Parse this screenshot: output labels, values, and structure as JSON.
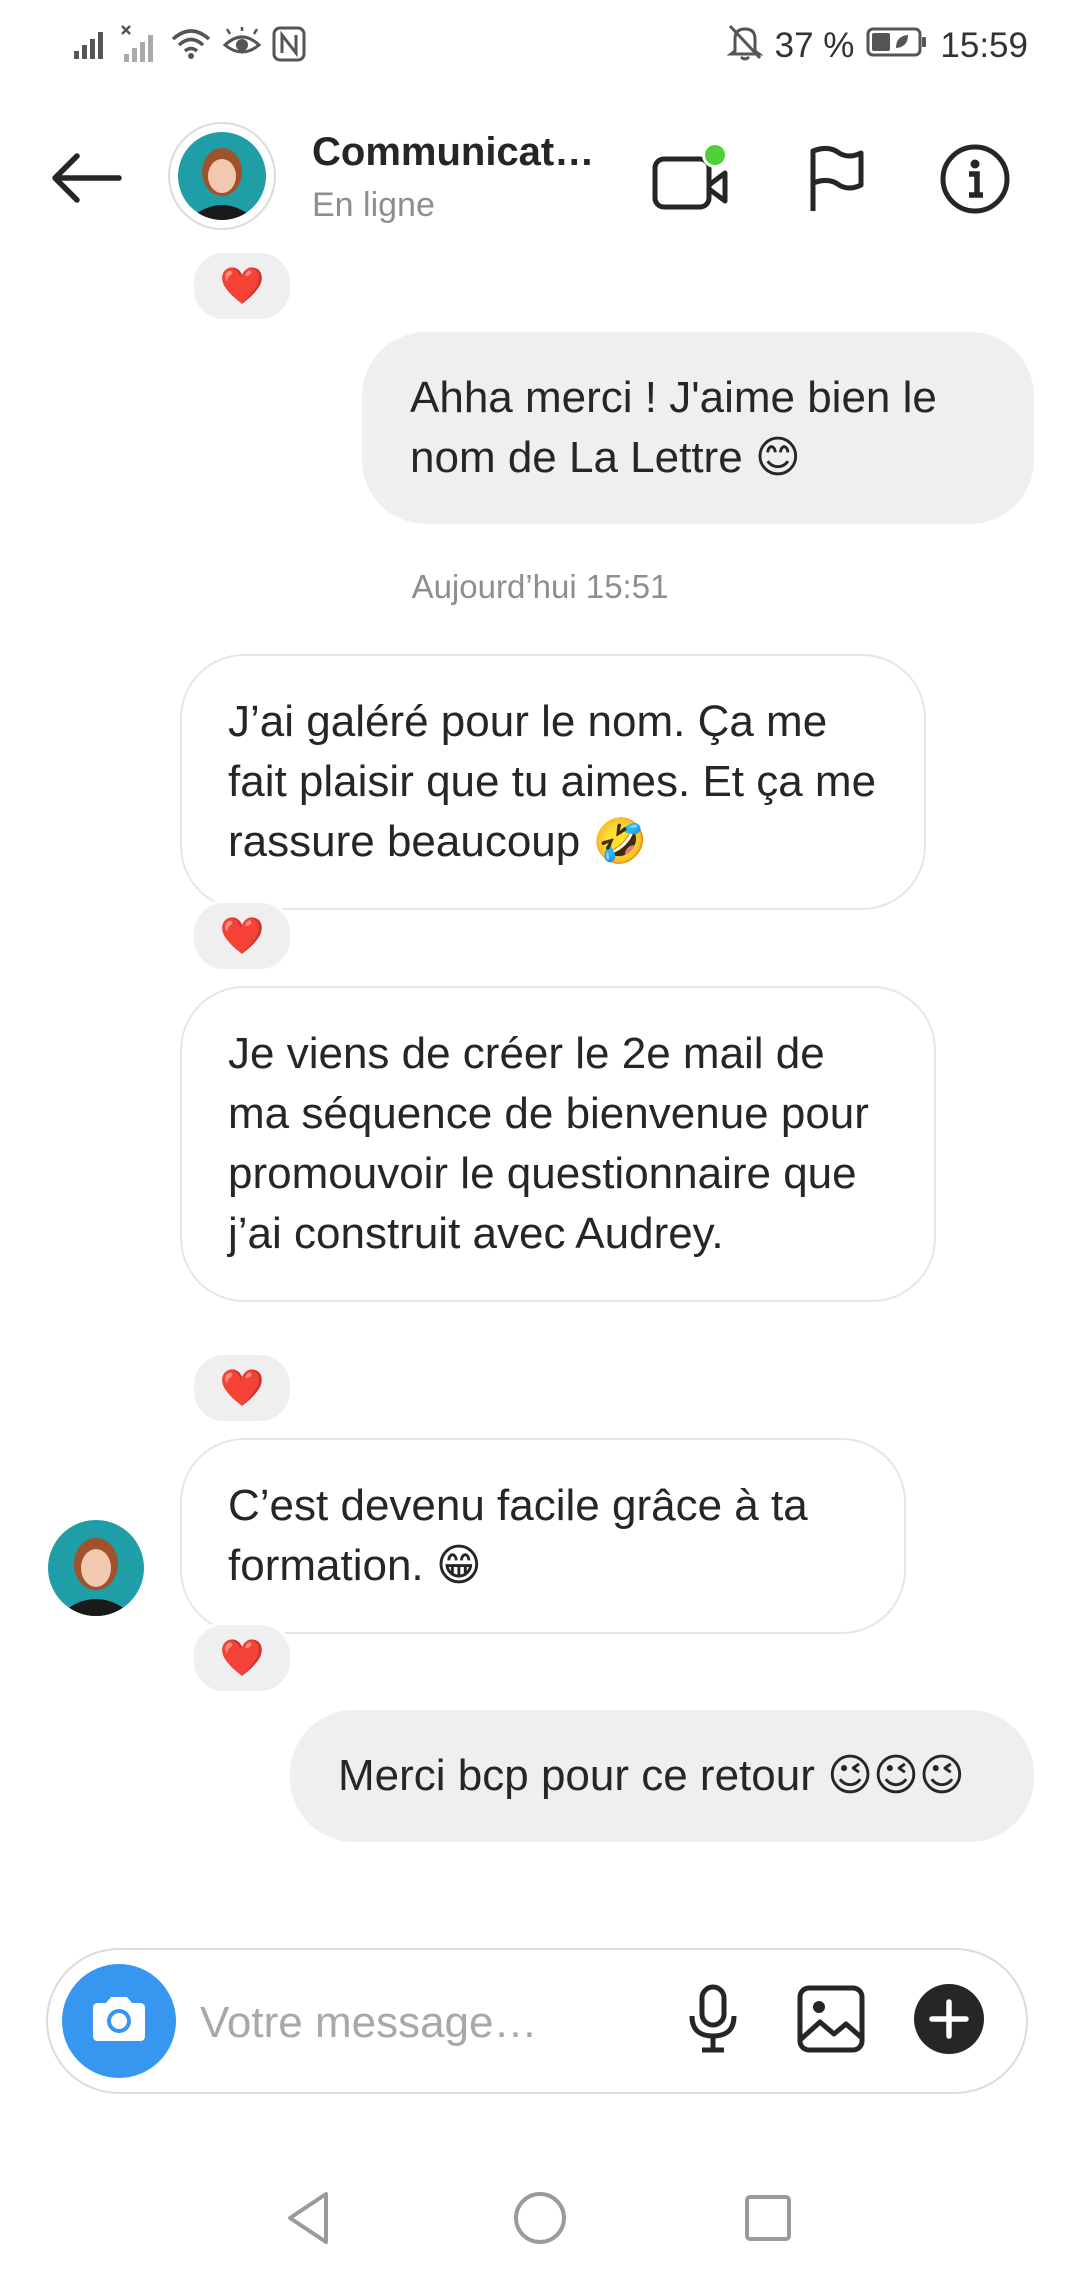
{
  "status_bar": {
    "battery_percent": "37 %",
    "time": "15:59",
    "icons": [
      "signal-icon",
      "signal-no-service-icon",
      "wifi-icon",
      "eye-comfort-icon",
      "nfc-icon",
      "bell-muted-icon",
      "battery-icon"
    ]
  },
  "header": {
    "contact_name": "Communicat…",
    "status": "En ligne",
    "icons": [
      "back-arrow-icon",
      "video-call-icon",
      "flag-icon",
      "info-icon"
    ],
    "online_dot_color": "#4cd137"
  },
  "conversation": {
    "messages": [
      {
        "id": "m1",
        "direction": "outgoing",
        "text": "Ahha merci ! J'aime bien le nom de La Lettre 😊"
      },
      {
        "id": "ts",
        "type": "timestamp",
        "text": "Aujourd’hui 15:51"
      },
      {
        "id": "m2",
        "direction": "incoming",
        "text": "J’ai galéré pour le nom. Ça me fait plaisir que tu aimes. Et ça me rassure beaucoup 🤣",
        "reaction": "❤️"
      },
      {
        "id": "m3",
        "direction": "incoming",
        "text": "Je viens de créer le 2e mail de ma séquence de bienvenue pour promouvoir le questionnaire que j’ai construit avec Audrey.",
        "reaction": "❤️"
      },
      {
        "id": "m4",
        "direction": "incoming",
        "text": "C’est devenu facile grâce à ta formation. 😁",
        "reaction": "❤️"
      },
      {
        "id": "m5",
        "direction": "outgoing",
        "text": "Merci bcp pour ce retour 😉😉😉"
      }
    ],
    "top_partial_reaction": "❤️"
  },
  "composer": {
    "placeholder": "Votre message…",
    "value": "",
    "icons": [
      "camera-icon",
      "microphone-icon",
      "gallery-icon",
      "plus-icon"
    ],
    "camera_color": "#3797f0"
  },
  "nav_bar": {
    "icons": [
      "back-triangle-icon",
      "home-circle-icon",
      "recents-square-icon"
    ]
  }
}
